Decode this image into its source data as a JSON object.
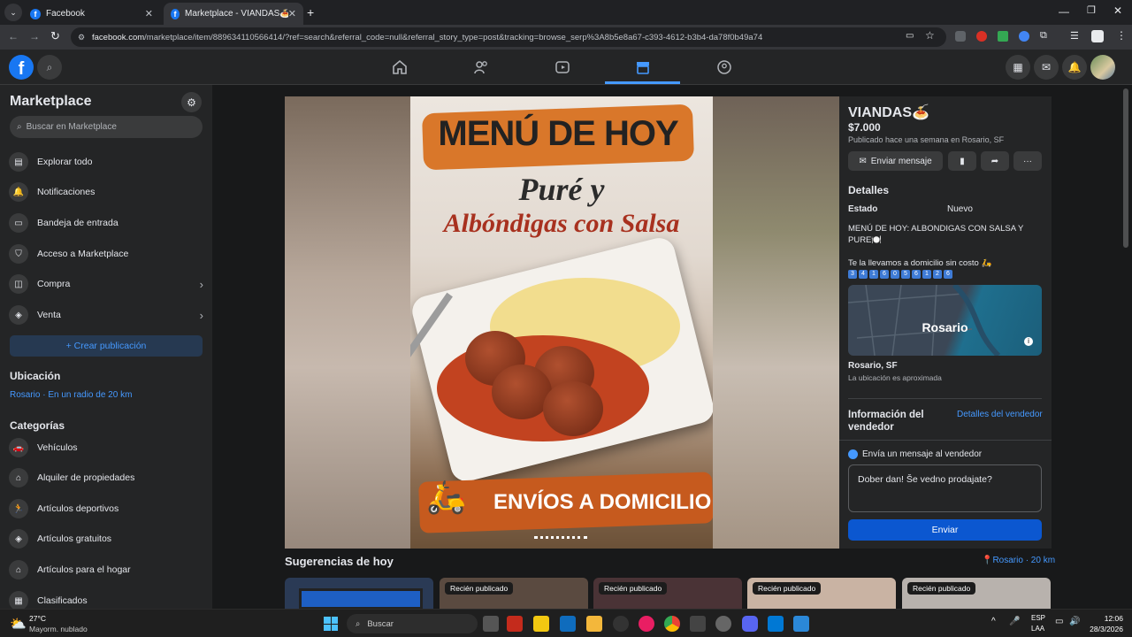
{
  "browser": {
    "tabs": [
      {
        "title": "Facebook"
      },
      {
        "title": "Marketplace - VIANDAS🍝 | Fa"
      }
    ],
    "url_domain": "facebook.com",
    "url_rest": "/marketplace/item/889634110566414/?ref=search&referral_code=null&referral_story_type=post&tracking=browse_serp%3A8b5e8a67-c393-4612-b3b4-da78f0b49a74"
  },
  "fb_logo": "f",
  "sidebar": {
    "title": "Marketplace",
    "search_placeholder": "Buscar en Marketplace",
    "items": [
      {
        "label": "Explorar todo",
        "icon": "store-icon"
      },
      {
        "label": "Notificaciones",
        "icon": "bell-icon"
      },
      {
        "label": "Bandeja de entrada",
        "icon": "inbox-icon"
      },
      {
        "label": "Acceso a Marketplace",
        "icon": "shield-icon"
      },
      {
        "label": "Compra",
        "icon": "bag-icon"
      },
      {
        "label": "Venta",
        "icon": "tag-icon"
      }
    ],
    "create_label": "+ Crear publicación",
    "location_heading": "Ubicación",
    "location_value": "Rosario · En un radio de 20 km",
    "categories_heading": "Categorías",
    "categories": [
      {
        "label": "Vehículos"
      },
      {
        "label": "Alquiler de propiedades"
      },
      {
        "label": "Artículos deportivos"
      },
      {
        "label": "Artículos gratuitos"
      },
      {
        "label": "Artículos para el hogar"
      },
      {
        "label": "Clasificados"
      }
    ]
  },
  "poster": {
    "line1": "MENÚ DE HOY",
    "line2": "Puré y",
    "line3": "Albóndigas con Salsa",
    "line4": "ENVÍOS A DOMICILIO"
  },
  "listing": {
    "title": "VIANDAS🍝",
    "price": "$7.000",
    "published": "Publicado hace una semana en Rosario, SF",
    "message_button": "Enviar mensaje",
    "details_heading": "Detalles",
    "condition_label": "Estado",
    "condition_value": "Nuevo",
    "description1": "MENÚ DE HOY: ALBONDIGAS CON SALSA Y PURE🍽️",
    "description2": "Te la llevamos a domicilio sin costo 🛵",
    "phone_digits": [
      "3",
      "4",
      "1",
      "6",
      "0",
      "5",
      "6",
      "1",
      "2",
      "6"
    ],
    "map_label": "Rosario",
    "location_name": "Rosario, SF",
    "location_note": "La ubicación es aproximada",
    "seller_heading": "Información del vendedor",
    "seller_link": "Detalles del vendedor",
    "send_heading": "Envía un mensaje al vendedor",
    "message_text": "Dober dan! Še vedno prodajate?",
    "send_button": "Enviar"
  },
  "suggestions": {
    "heading": "Sugerencias de hoy",
    "location": "Rosario · 20 km",
    "badges": [
      "Recién publicado",
      "Recién publicado",
      "Recién publicado",
      "Recién publicado"
    ]
  },
  "taskbar": {
    "weather_temp": "27°C",
    "weather_desc": "Mayorm. nublado",
    "search_placeholder": "Buscar",
    "lang1": "ESP",
    "lang2": "LAA",
    "time": "12:06",
    "date": "28/3/2026"
  },
  "colors": {
    "accent": "#1877f2",
    "link": "#4599ff",
    "bg": "#18191a",
    "panel": "#242526"
  }
}
